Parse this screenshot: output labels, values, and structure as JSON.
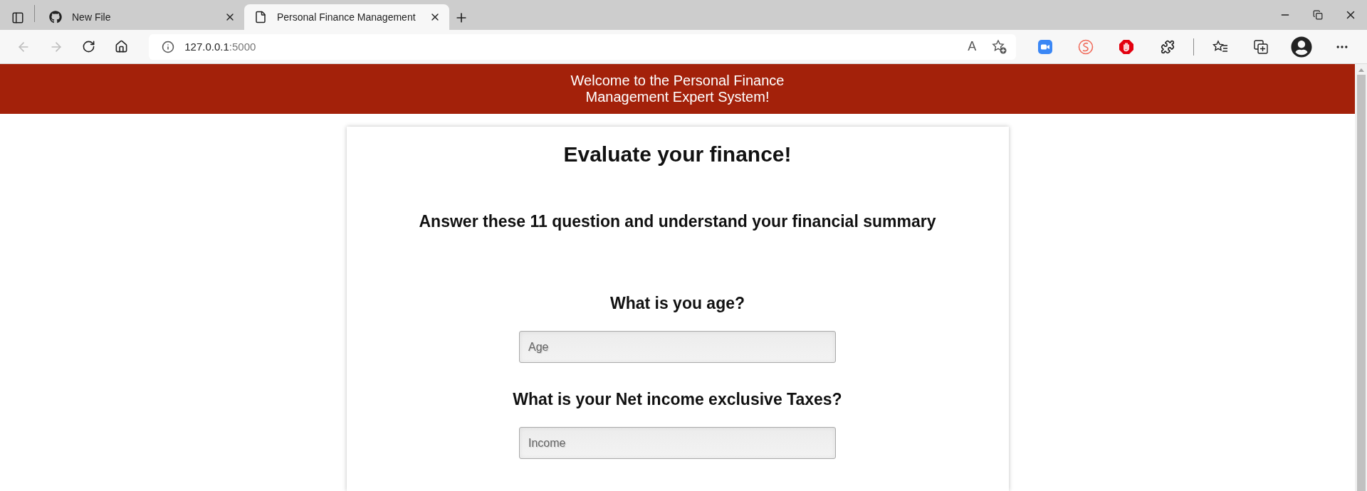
{
  "browser": {
    "tabs": [
      {
        "title": "New File",
        "kind": "favicon",
        "selected": false
      },
      {
        "title": "Personal Finance Management",
        "kind": "document",
        "selected": true
      }
    ],
    "address": {
      "host": "127.0.0.1",
      "port": ":5000"
    },
    "read_aloud_mark": "A"
  },
  "header": {
    "lines": [
      "Welcome to the Personal Finance",
      "Management Expert System!"
    ]
  },
  "card": {
    "title": "Evaluate your finance!",
    "subtitle": "Answer these 11 question and understand your financial summary",
    "questions": [
      {
        "label": "What is you age?",
        "placeholder": "Age"
      },
      {
        "label": "What is your Net income exclusive Taxes?",
        "placeholder": "Income"
      }
    ]
  }
}
